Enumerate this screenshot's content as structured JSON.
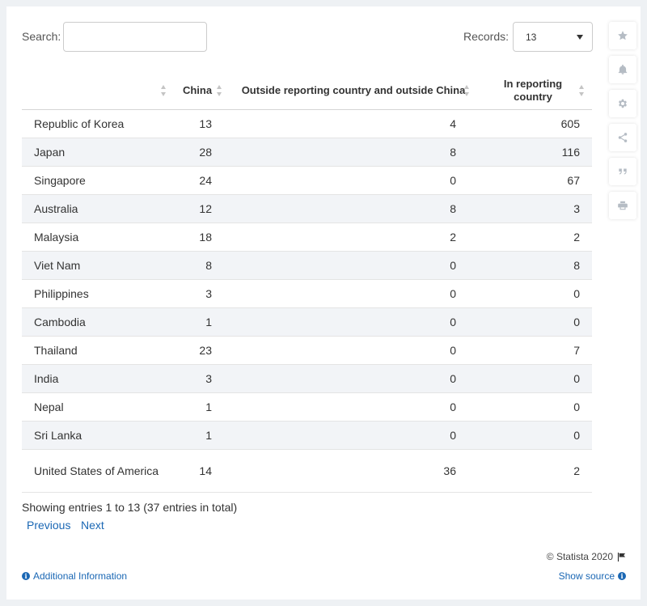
{
  "controls": {
    "search_label": "Search:",
    "search_value": "",
    "records_label": "Records:",
    "records_value": "13"
  },
  "table": {
    "columns": [
      "",
      "China",
      "Outside reporting country and outside China",
      "In reporting country"
    ],
    "rows": [
      {
        "country": "Republic of Korea",
        "china": "13",
        "outside": "4",
        "in_reporting": "605"
      },
      {
        "country": "Japan",
        "china": "28",
        "outside": "8",
        "in_reporting": "116"
      },
      {
        "country": "Singapore",
        "china": "24",
        "outside": "0",
        "in_reporting": "67"
      },
      {
        "country": "Australia",
        "china": "12",
        "outside": "8",
        "in_reporting": "3"
      },
      {
        "country": "Malaysia",
        "china": "18",
        "outside": "2",
        "in_reporting": "2"
      },
      {
        "country": "Viet Nam",
        "china": "8",
        "outside": "0",
        "in_reporting": "8"
      },
      {
        "country": "Philippines",
        "china": "3",
        "outside": "0",
        "in_reporting": "0"
      },
      {
        "country": "Cambodia",
        "china": "1",
        "outside": "0",
        "in_reporting": "0"
      },
      {
        "country": "Thailand",
        "china": "23",
        "outside": "0",
        "in_reporting": "7"
      },
      {
        "country": "India",
        "china": "3",
        "outside": "0",
        "in_reporting": "0"
      },
      {
        "country": "Nepal",
        "china": "1",
        "outside": "0",
        "in_reporting": "0"
      },
      {
        "country": "Sri Lanka",
        "china": "1",
        "outside": "0",
        "in_reporting": "0"
      },
      {
        "country": "United States of America",
        "china": "14",
        "outside": "36",
        "in_reporting": "2"
      }
    ]
  },
  "footer": {
    "showing": "Showing entries 1 to 13 (37 entries in total)",
    "previous": "Previous",
    "next": "Next",
    "copyright": "© Statista 2020",
    "additional_info": "Additional Information",
    "show_source": "Show source"
  },
  "rail_icons": [
    "star-icon",
    "bell-icon",
    "gear-icon",
    "share-icon",
    "quote-icon",
    "print-icon"
  ],
  "colors": {
    "link": "#1a67b4",
    "row_alt": "#f2f4f7",
    "icon": "#b5bcc4"
  }
}
